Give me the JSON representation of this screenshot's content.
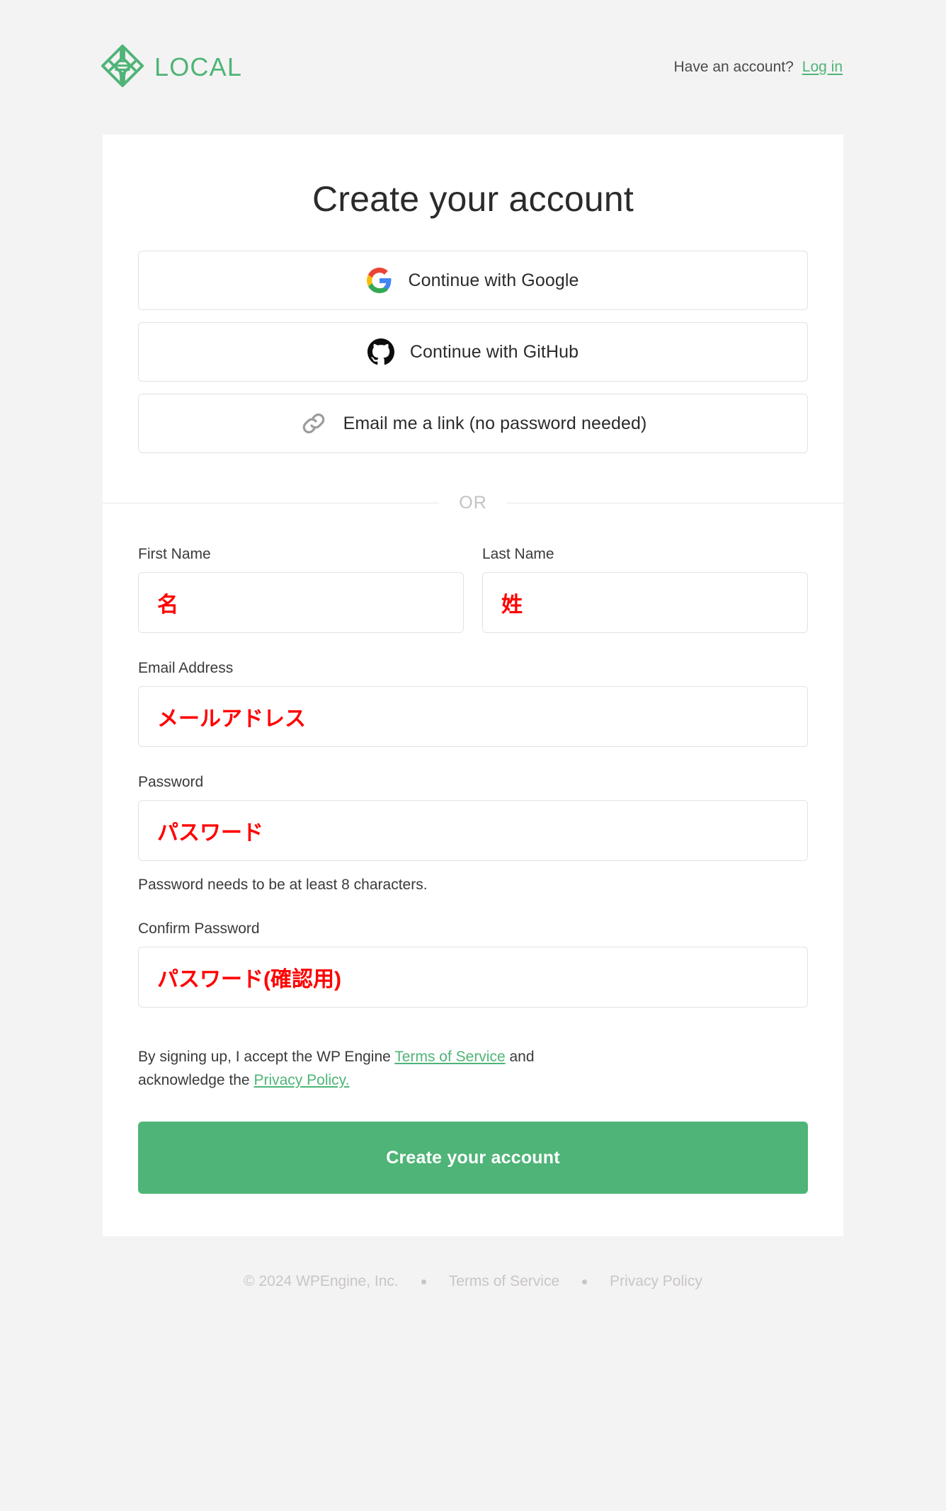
{
  "brand": {
    "name": "LOCAL",
    "logo_icon": "local-diamond-logo",
    "accent_color": "#4fb477"
  },
  "header": {
    "have_account_text": "Have an account?",
    "login_link": "Log in"
  },
  "card": {
    "title": "Create your account"
  },
  "oauth_buttons": [
    {
      "label": "Continue with Google",
      "icon": "google-g-icon"
    },
    {
      "label": "Continue with GitHub",
      "icon": "github-octocat-icon"
    },
    {
      "label": "Email me a link (no password needed)",
      "icon": "link-chain-icon"
    }
  ],
  "divider": {
    "text": "OR"
  },
  "form": {
    "first_name": {
      "label": "First Name",
      "value": "名",
      "placeholder": ""
    },
    "last_name": {
      "label": "Last Name",
      "value": "姓",
      "placeholder": ""
    },
    "email": {
      "label": "Email Address",
      "value": "メールアドレス",
      "placeholder": ""
    },
    "password": {
      "label": "Password",
      "value": "パスワード",
      "placeholder": "",
      "hint": "Password needs to be at least 8 characters."
    },
    "confirm_password": {
      "label": "Confirm Password",
      "value": "パスワード(確認用)",
      "placeholder": ""
    },
    "value_color": "#ff0000"
  },
  "terms": {
    "prefix": "By signing up, I accept the WP Engine ",
    "terms_link": "Terms of Service",
    "middle": " and acknowledge the ",
    "privacy_link": "Privacy Policy."
  },
  "submit": {
    "label": "Create your account",
    "color": "#4fb477"
  },
  "footer": {
    "copyright": "© 2024 WPEngine, Inc.",
    "terms_link": "Terms of Service",
    "privacy_link": "Privacy Policy"
  }
}
